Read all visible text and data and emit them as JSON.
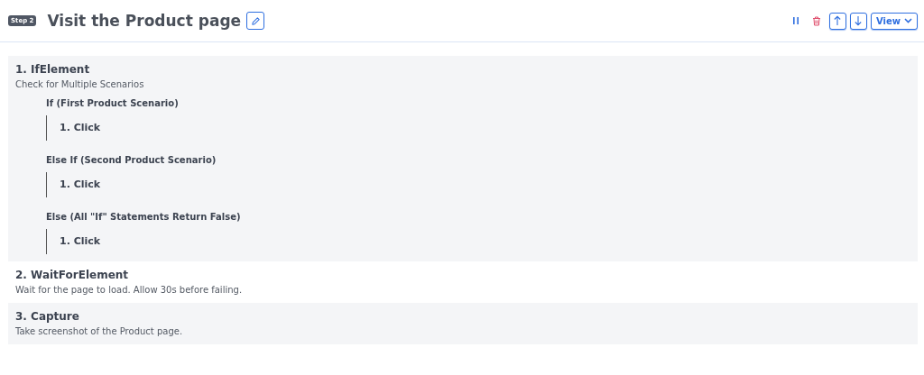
{
  "step": {
    "badge": "Step 2",
    "title": "Visit the Product page"
  },
  "toolbar": {
    "view_label": "View"
  },
  "actions": [
    {
      "title": "1. IfElement",
      "description": "Check for Multiple Scenarios",
      "branches": [
        {
          "label": "If (First Product Scenario)",
          "children": [
            {
              "title": "1. Click"
            }
          ]
        },
        {
          "label": "Else If (Second Product Scenario)",
          "children": [
            {
              "title": "1. Click"
            }
          ]
        },
        {
          "label": "Else (All \"If\" Statements Return False)",
          "children": [
            {
              "title": "1. Click"
            }
          ]
        }
      ]
    },
    {
      "title": "2. WaitForElement",
      "description": "Wait for the page to load. Allow 30s before failing."
    },
    {
      "title": "3. Capture",
      "description": "Take screenshot of the Product page."
    }
  ]
}
